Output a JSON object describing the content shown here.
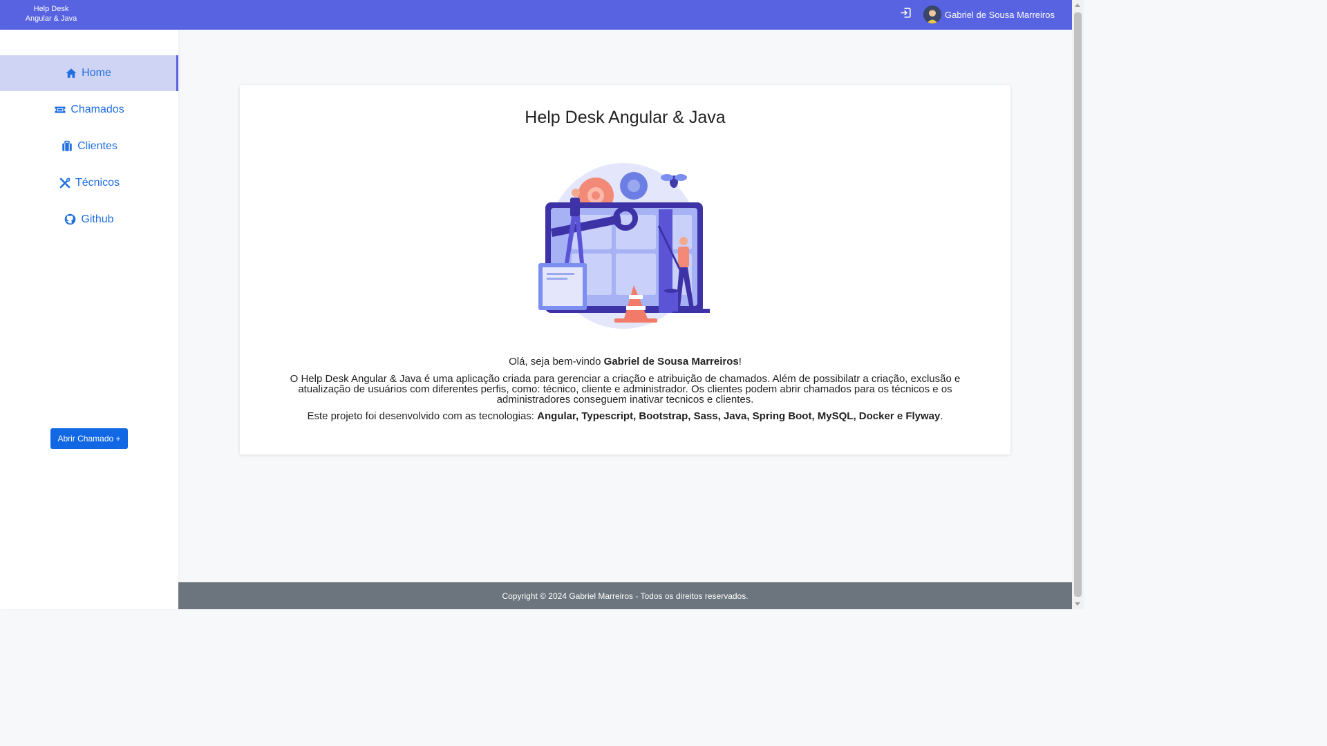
{
  "header": {
    "brand_line1": "Help Desk",
    "brand_line2": "Angular & Java",
    "logout_icon": "logout-icon",
    "user_name": "Gabriel de Sousa Marreiros"
  },
  "sidebar": {
    "items": [
      {
        "label": "Home",
        "icon": "home-icon",
        "active": true
      },
      {
        "label": "Chamados",
        "icon": "ticket-icon",
        "active": false
      },
      {
        "label": "Clientes",
        "icon": "briefcase-icon",
        "active": false
      },
      {
        "label": "Técnicos",
        "icon": "tools-icon",
        "active": false
      },
      {
        "label": "Github",
        "icon": "github-icon",
        "active": false
      }
    ],
    "open_ticket_button": "Abrir Chamado +"
  },
  "main": {
    "title": "Help Desk Angular & Java",
    "welcome_prefix": "Olá, seja bem-vindo ",
    "welcome_name": "Gabriel de Sousa Marreiros",
    "welcome_suffix": "!",
    "description": "O Help Desk Angular & Java é uma aplicação criada para gerenciar a criação e atribuição de chamados. Além de possibilatr a criação, exclusão e atualização de usuários com diferentes perfis, como: técnico, cliente e administrador. Os clientes podem abrir chamados para os técnicos e os administradores conseguem inativar tecnicos e clientes.",
    "tech_prefix": "Este projeto foi desenvolvido com as tecnologias: ",
    "tech_list": "Angular, Typescript, Bootstrap, Sass, Java, Spring Boot, MySQL, Docker e Flyway",
    "tech_suffix": "."
  },
  "footer": {
    "text": "Copyright © 2024 Gabriel Marreiros - Todos os direitos reservados."
  },
  "colors": {
    "topbar": "#5763e0",
    "link": "#1f6fe0",
    "active_bg": "#d0d4f4",
    "button": "#1267e4",
    "footer": "#6c757d"
  }
}
